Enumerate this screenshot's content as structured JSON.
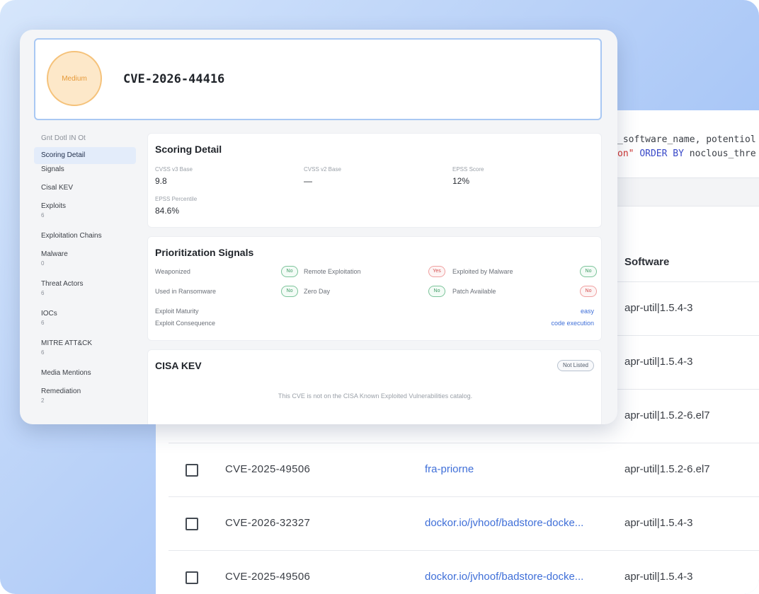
{
  "sql": {
    "line1": "_software_name, potentiol",
    "line2_str": "on\"",
    "line2_kw1": "ORDER BY",
    "line2_rest": "noclous_thre"
  },
  "table": {
    "software_header": "Software",
    "rows": [
      {
        "cve": "",
        "image": "",
        "software": "apr-util|1.5.4-3",
        "checkbox": false
      },
      {
        "cve": "",
        "image": "",
        "software": "apr-util|1.5.4-3",
        "checkbox": false
      },
      {
        "cve": "",
        "image": "",
        "software": "apr-util|1.5.2-6.el7",
        "checkbox": false
      },
      {
        "cve": "CVE-2025-49506",
        "image": "fra-priorne",
        "software": "apr-util|1.5.2-6.el7",
        "checkbox": true
      },
      {
        "cve": "CVE-2026-32327",
        "image": "dockor.io/jvhoof/badstore-docke...",
        "software": "apr-util|1.5.4-3",
        "checkbox": true
      },
      {
        "cve": "CVE-2025-49506",
        "image": "dockor.io/jvhoof/badstore-docke...",
        "software": "apr-util|1.5.4-3",
        "checkbox": true
      }
    ]
  },
  "detail": {
    "severity": "Medium",
    "cve_id": "CVE-2026-44416",
    "nav": {
      "heading": "Gnt Dotl IN Ot",
      "items": [
        {
          "label": "Scoring Detail",
          "count": "",
          "active": true
        },
        {
          "label": "Signals",
          "count": ""
        },
        {
          "label": "Cisal KEV",
          "count": ""
        },
        {
          "label": "Exploits",
          "count": "6"
        },
        {
          "label": "Exploitation Chains",
          "count": ""
        },
        {
          "label": "Malware",
          "count": "0"
        },
        {
          "label": "Threat Actors",
          "count": "6"
        },
        {
          "label": "IOCs",
          "count": "6"
        },
        {
          "label": "MITRE ATT&CK",
          "count": "6"
        },
        {
          "label": "Media Mentions",
          "count": ""
        },
        {
          "label": "Remediation",
          "count": "2"
        }
      ]
    },
    "scoring": {
      "title": "Scoring Detail",
      "cvss3_label": "CVSS v3 Base",
      "cvss3_value": "9.8",
      "cvss2_label": "CVSS v2 Base",
      "cvss2_value": "—",
      "epss_label": "EPSS Score",
      "epss_value": "12%",
      "epss_pct_label": "EPSS Percentile",
      "epss_pct_value": "84.6%"
    },
    "signals": {
      "title": "Prioritization Signals",
      "items": [
        {
          "label": "Weaponized",
          "value": "No",
          "status": "yes"
        },
        {
          "label": "Remote Exploitation",
          "value": "Yes",
          "status": "no"
        },
        {
          "label": "Exploited by Malware",
          "value": "No",
          "status": "yes"
        },
        {
          "label": "Used in Ransomware",
          "value": "No",
          "status": "yes"
        },
        {
          "label": "Zero Day",
          "value": "No",
          "status": "yes"
        },
        {
          "label": "Patch Available",
          "value": "No",
          "status": "no"
        }
      ],
      "maturity_label": "Exploit Maturity",
      "maturity_value": "easy",
      "consequence_label": "Exploit Consequence",
      "consequence_value": "code execution"
    },
    "kev": {
      "title": "CISA KEV",
      "badge": "Not Listed",
      "note": "This CVE is not on the CISA Known Exploited Vulnerabilities catalog."
    }
  }
}
